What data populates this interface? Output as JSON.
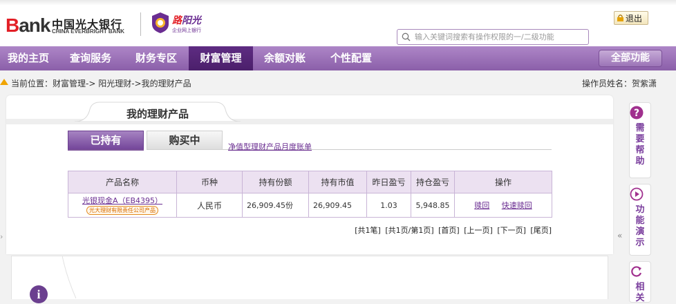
{
  "header": {
    "logo_text": "Bank",
    "bank_name_cn": "中国光大银行",
    "bank_name_en": "CHINA EVERBRIGHT BANK",
    "brand_title": "阳光",
    "brand_sub": "企业网上银行",
    "exit_label": "退出",
    "search_placeholder": "输入关键词搜索有操作权限的一/二级功能"
  },
  "nav": {
    "items": [
      {
        "label": "我的主页"
      },
      {
        "label": "查询服务"
      },
      {
        "label": "财务专区"
      },
      {
        "label": "财富管理",
        "active": true
      },
      {
        "label": "余额对账"
      },
      {
        "label": "个性配置"
      }
    ],
    "all_functions_label": "全部功能"
  },
  "breadcrumb": {
    "text": "当前位置：财富管理->  阳光理财->我的理财产品",
    "operator": "操作员姓名：贺紫潇"
  },
  "main": {
    "page_tab": "我的理财产品",
    "tabs": [
      {
        "label": "已持有",
        "active": true
      },
      {
        "label": "购买中",
        "active": false
      }
    ],
    "report_link": "净值型理财产品月度账单",
    "table": {
      "headers": [
        "产品名称",
        "币种",
        "持有份额",
        "持有市值",
        "昨日盈亏",
        "持仓盈亏",
        "操作"
      ],
      "rows": [
        {
          "product_name": "光银现金A（EB4395）",
          "product_tag": "光大理财有限责任公司产品",
          "currency": "人民币",
          "shares": "26,909.45份",
          "market_value": "26,909.45",
          "yesterday_pnl": "1.03",
          "position_pnl": "5,948.85",
          "actions": [
            "赎回",
            "快速赎回"
          ]
        }
      ]
    },
    "pager": [
      "[共1笔]",
      "[共1页/第1页]",
      "[首页]",
      "[上一页]",
      "[下一页]",
      "[尾页]"
    ]
  },
  "side": {
    "buttons": [
      {
        "label": "需要帮助",
        "icon": "question-icon"
      },
      {
        "label": "功能演示",
        "icon": "play-icon"
      },
      {
        "label": "相关",
        "icon": "refresh-icon"
      }
    ],
    "collapse_left": "›",
    "collapse_right": "«"
  },
  "lower": {
    "info_icon": "i"
  },
  "colors": {
    "brand_purple": "#6a2d91",
    "nav_purple": "#9a70b6",
    "nav_active": "#54247a",
    "logo_red": "#e21f26"
  }
}
